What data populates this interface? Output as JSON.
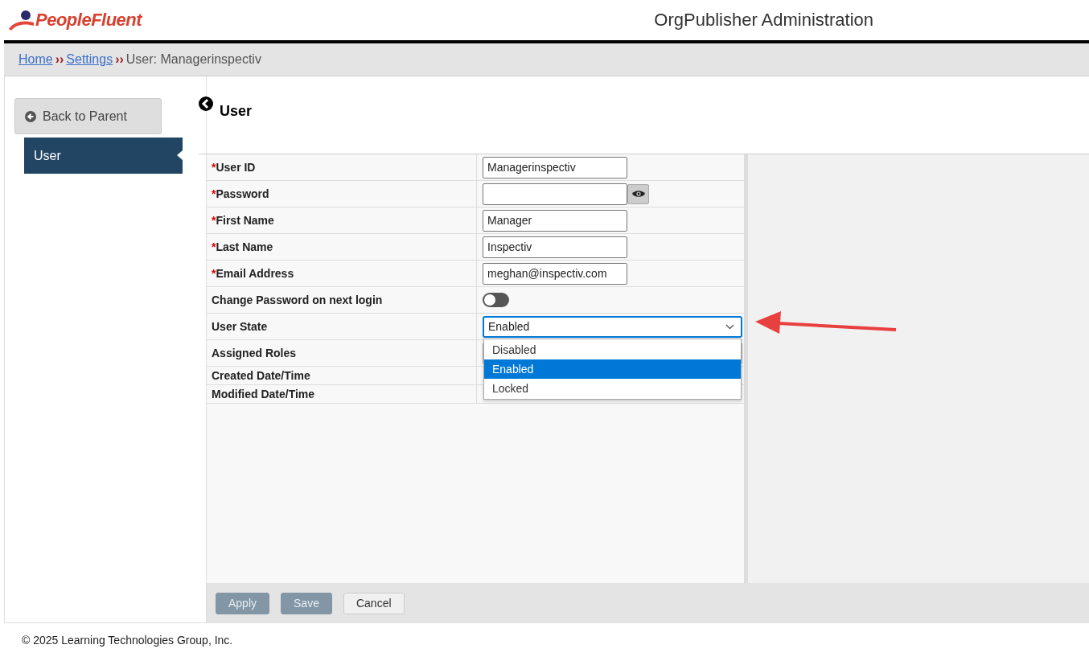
{
  "header": {
    "logo": "PeopleFluent",
    "title": "OrgPublisher Administration"
  },
  "breadcrumb": {
    "separator": "››",
    "items": [
      {
        "label": "Home",
        "kind": "link"
      },
      {
        "label": "Settings",
        "kind": "link"
      },
      {
        "label": "User: Managerinspectiv",
        "kind": "current"
      }
    ]
  },
  "sidebar": {
    "back_button": "Back to Parent",
    "items": [
      {
        "label": "User",
        "selected": true
      }
    ]
  },
  "form": {
    "title": "User",
    "fields": [
      {
        "label": "User ID",
        "required_mark": "*",
        "kind": "text",
        "value": "Managerinspectiv"
      },
      {
        "label": "Password",
        "required_mark": "*",
        "kind": "password"
      },
      {
        "label": "First Name",
        "required_mark": "*",
        "kind": "text",
        "value": "Manager"
      },
      {
        "label": "Last Name",
        "required_mark": "*",
        "kind": "text",
        "value": "Inspectiv"
      },
      {
        "label": "Email Address",
        "required_mark": "*",
        "kind": "text",
        "value": "meghan@inspectiv.com"
      },
      {
        "label": "Change Password on next login",
        "kind": "toggle",
        "on": false
      },
      {
        "label": "User State",
        "kind": "select",
        "value": "Enabled",
        "expanded": true,
        "options": [
          {
            "label": "Disabled",
            "selected": false
          },
          {
            "label": "Enabled",
            "selected": true
          },
          {
            "label": "Locked",
            "selected": false
          }
        ]
      },
      {
        "label": "Assigned Roles",
        "kind": "roles"
      },
      {
        "label": "Created Date/Time",
        "kind": "date"
      },
      {
        "label": "Modified Date/Time",
        "kind": "date"
      }
    ]
  },
  "buttons": [
    {
      "label": "Apply",
      "disabled": true
    },
    {
      "label": "Save",
      "disabled": true
    },
    {
      "label": "Cancel",
      "disabled": false
    }
  ],
  "footer": "© 2025 Learning Technologies Group, Inc."
}
